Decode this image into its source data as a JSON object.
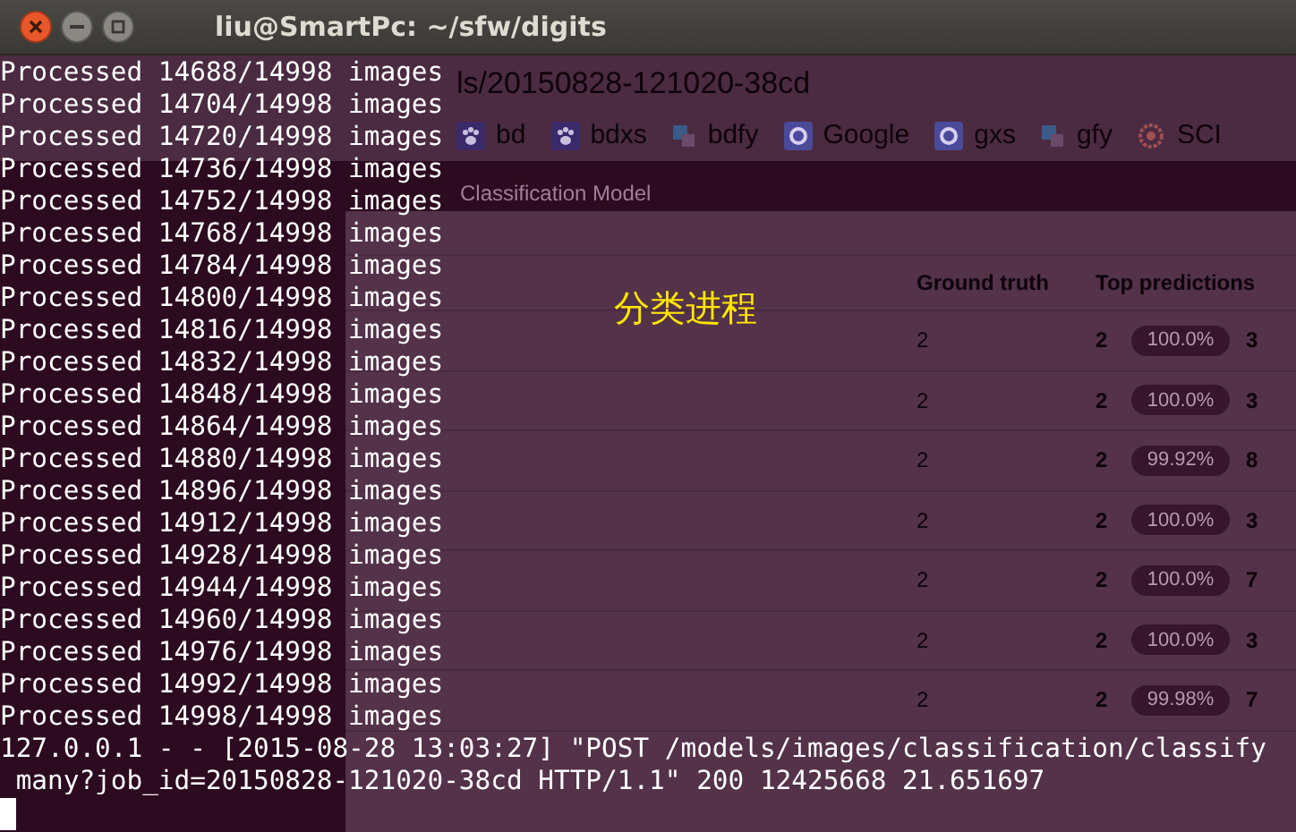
{
  "window": {
    "title": "liu@SmartPc: ~/sfw/digits"
  },
  "terminal": {
    "lines": [
      "Processed 14688/14998 images",
      "Processed 14704/14998 images",
      "Processed 14720/14998 images",
      "Processed 14736/14998 images",
      "Processed 14752/14998 images",
      "Processed 14768/14998 images",
      "Processed 14784/14998 images",
      "Processed 14800/14998 images",
      "Processed 14816/14998 images",
      "Processed 14832/14998 images",
      "Processed 14848/14998 images",
      "Processed 14864/14998 images",
      "Processed 14880/14998 images",
      "Processed 14896/14998 images",
      "Processed 14912/14998 images",
      "Processed 14928/14998 images",
      "Processed 14944/14998 images",
      "Processed 14960/14998 images",
      "Processed 14976/14998 images",
      "Processed 14992/14998 images",
      "Processed 14998/14998 images",
      "127.0.0.1 - - [2015-08-28 13:03:27] \"POST /models/images/classification/classify",
      " many?job_id=20150828-121020-38cd HTTP/1.1\" 200 12425668 21.651697"
    ]
  },
  "annotation": "分类进程",
  "browser": {
    "url": "ls/20150828-121020-38cd",
    "bookmarks": [
      {
        "label": "bd",
        "kind": "paw"
      },
      {
        "label": "bdxs",
        "kind": "paw"
      },
      {
        "label": "bdfy",
        "kind": "translate"
      },
      {
        "label": "Google",
        "kind": "g"
      },
      {
        "label": "gxs",
        "kind": "g"
      },
      {
        "label": "gfy",
        "kind": "translate"
      },
      {
        "label": "SCI",
        "kind": "ring"
      }
    ],
    "heading": "Classification Model",
    "table": {
      "columns": [
        "Ground truth",
        "Top predictions"
      ],
      "rows": [
        {
          "ground_truth": "2",
          "prediction": "2",
          "confidence": "100.0%",
          "next": "3"
        },
        {
          "ground_truth": "2",
          "prediction": "2",
          "confidence": "100.0%",
          "next": "3"
        },
        {
          "ground_truth": "2",
          "prediction": "2",
          "confidence": "99.92%",
          "next": "8"
        },
        {
          "ground_truth": "2",
          "prediction": "2",
          "confidence": "100.0%",
          "next": "3"
        },
        {
          "ground_truth": "2",
          "prediction": "2",
          "confidence": "100.0%",
          "next": "7"
        },
        {
          "ground_truth": "2",
          "prediction": "2",
          "confidence": "100.0%",
          "next": "3"
        },
        {
          "ground_truth": "2",
          "prediction": "2",
          "confidence": "99.98%",
          "next": "7"
        }
      ]
    }
  }
}
